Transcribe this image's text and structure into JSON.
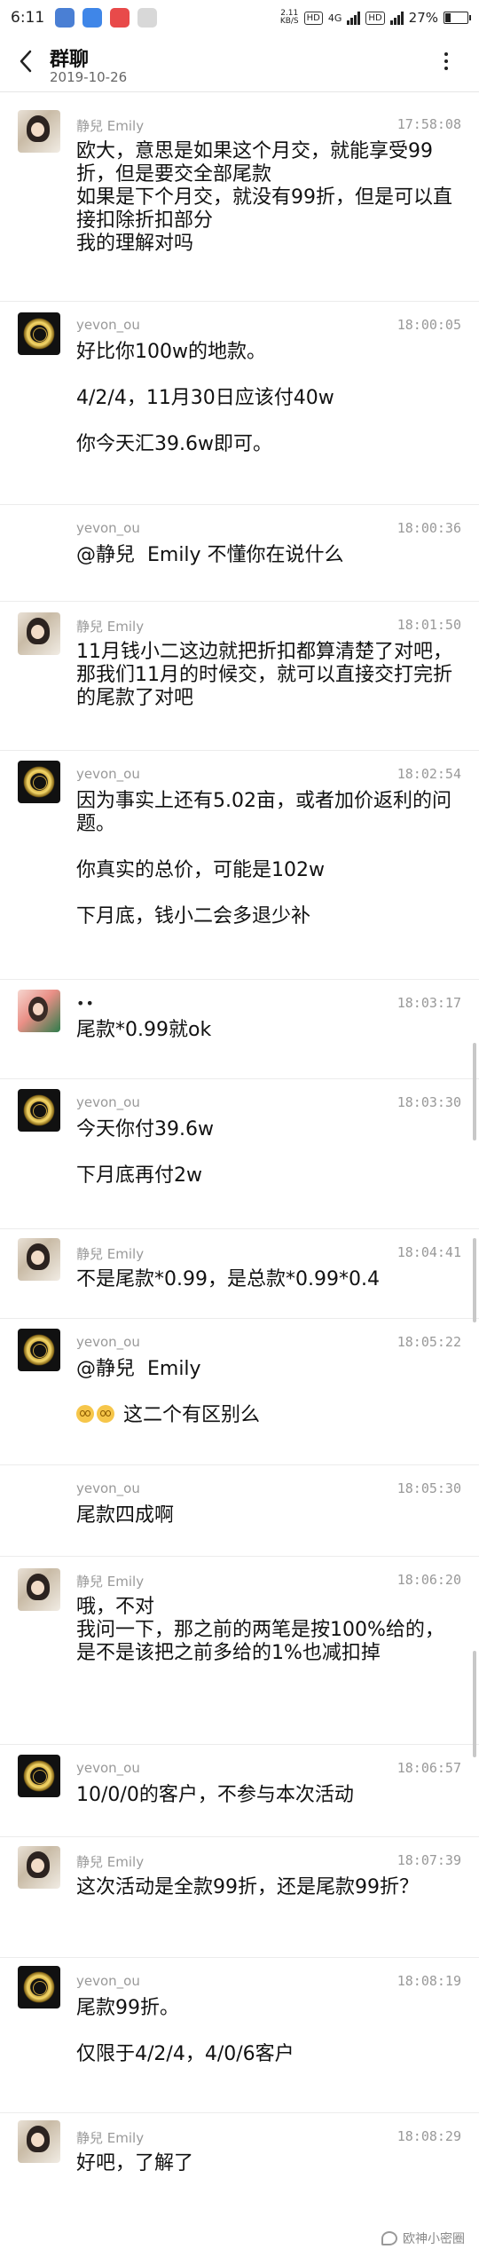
{
  "status_bar": {
    "time": "6:11",
    "speed_value": "2.11",
    "speed_unit": "KB/S",
    "hd": "HD",
    "network": "4G",
    "battery": "27%",
    "battery_level": 0.27
  },
  "header": {
    "title": "群聊",
    "date": "2019-10-26"
  },
  "messages": [
    {
      "sender": "静兒  Emily",
      "avatar": "girl",
      "time": "17:58:08",
      "text": "欧大，意思是如果这个月交，就能享受99折，但是要交全部尾款\n如果是下个月交，就没有99折，但是可以直接扣除折扣部分\n我的理解对吗"
    },
    {
      "sender": "yevon_ou",
      "avatar": "yevon",
      "time": "18:00:05",
      "text": "好比你100w的地款。\n\n4/2/4，11月30日应该付40w\n\n你今天汇39.6w即可。"
    },
    {
      "sender": "yevon_ou",
      "avatar": "",
      "time": "18:00:36",
      "text": "@静兒  Emily 不懂你在说什么"
    },
    {
      "sender": "静兒  Emily",
      "avatar": "girl",
      "time": "18:01:50",
      "text": "11月钱小二这边就把折扣都算清楚了对吧，那我们11月的时候交，就可以直接交打完折的尾款了对吧"
    },
    {
      "sender": "yevon_ou",
      "avatar": "yevon",
      "time": "18:02:54",
      "text": "因为事实上还有5.02亩，或者加价返利的问题。\n\n你真实的总价，可能是102w\n\n下月底，钱小二会多退少补"
    },
    {
      "sender": "••",
      "avatar": "red",
      "time": "18:03:17",
      "text": "尾款*0.99就ok"
    },
    {
      "sender": "yevon_ou",
      "avatar": "yevon",
      "time": "18:03:30",
      "text": "今天你付39.6w\n\n下月底再付2w"
    },
    {
      "sender": "静兒  Emily",
      "avatar": "girl",
      "time": "18:04:41",
      "text": "不是尾款*0.99，是总款*0.99*0.4"
    },
    {
      "sender": "yevon_ou",
      "avatar": "yevon",
      "time": "18:05:22",
      "text": "@静兒  Emily\n\n 这二个有区别么"
    },
    {
      "sender": "yevon_ou",
      "avatar": "",
      "time": "18:05:30",
      "text": "尾款四成啊"
    },
    {
      "sender": "静兒  Emily",
      "avatar": "girl",
      "time": "18:06:20",
      "text": "哦，不对\n我问一下，那之前的两笔是按100%给的，是不是该把之前多给的1%也减扣掉"
    },
    {
      "sender": "yevon_ou",
      "avatar": "yevon",
      "time": "18:06:57",
      "text": "10/0/0的客户，不参与本次活动"
    },
    {
      "sender": "静兒  Emily",
      "avatar": "girl",
      "time": "18:07:39",
      "text": "这次活动是全款99折，还是尾款99折？"
    },
    {
      "sender": "yevon_ou",
      "avatar": "yevon",
      "time": "18:08:19",
      "text": "尾款99折。\n\n仅限于4/2/4，4/0/6客户"
    },
    {
      "sender": "静兒  Emily",
      "avatar": "girl",
      "time": "18:08:29",
      "text": "好吧，了解了"
    }
  ],
  "watermark": "欧神小密圈"
}
